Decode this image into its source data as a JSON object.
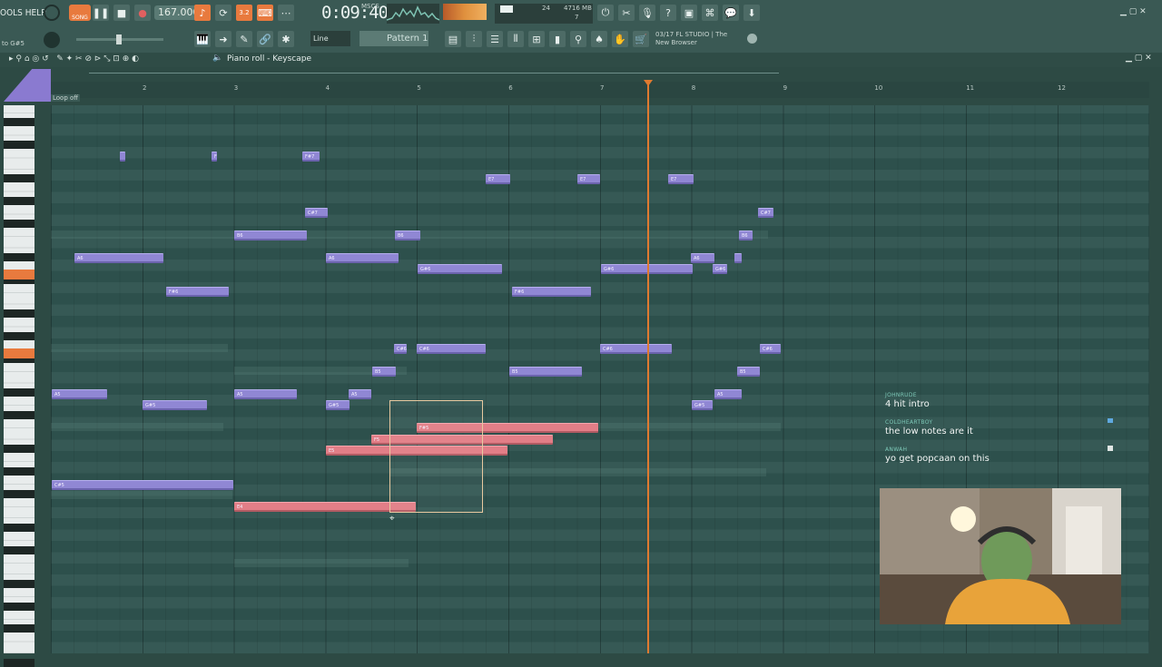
{
  "menu": {
    "tools_help": "OOLS HELP",
    "to_note": "to G#5",
    "song_label": "SONG"
  },
  "transport": {
    "tempo": "167.000",
    "time": "0:09:40",
    "time_sub": "MSCS",
    "pattern_sel": "3.2"
  },
  "resources": {
    "cpu": "24",
    "mem": "4716 MB",
    "polyphony": "7"
  },
  "toolbar2": {
    "tool_mode": "Line",
    "pattern": "Pattern 1"
  },
  "news": {
    "line1": "03/17  FL STUDIO | The",
    "line2": "New Browser"
  },
  "pianoroll": {
    "title": "Piano roll - Keyscape",
    "loop": "Loop off",
    "bars": [
      "2",
      "3",
      "4",
      "5",
      "6",
      "7",
      "8",
      "9",
      "10",
      "11",
      "12"
    ]
  },
  "notes": [
    {
      "label": "",
      "color": "purple"
    },
    {
      "label": "F",
      "color": "purple"
    },
    {
      "label": "F#7",
      "color": "purple"
    },
    {
      "label": "E7",
      "color": "purple"
    },
    {
      "label": "E7",
      "color": "purple"
    },
    {
      "label": "E7",
      "color": "purple"
    },
    {
      "label": "C#7",
      "color": "purple"
    },
    {
      "label": "C#7",
      "color": "purple"
    },
    {
      "label": "B6",
      "color": "purple"
    },
    {
      "label": "B6",
      "color": "purple"
    },
    {
      "label": "B6",
      "color": "purple"
    },
    {
      "label": "A6",
      "color": "purple"
    },
    {
      "label": "A6",
      "color": "purple"
    },
    {
      "label": "A6",
      "color": "purple"
    },
    {
      "label": "",
      "color": "purple"
    },
    {
      "label": "G#6",
      "color": "purple"
    },
    {
      "label": "G#6",
      "color": "purple"
    },
    {
      "label": "G#6",
      "color": "purple"
    },
    {
      "label": "F#6",
      "color": "purple"
    },
    {
      "label": "F#6",
      "color": "purple"
    },
    {
      "label": "C#6",
      "color": "purple"
    },
    {
      "label": "C#6",
      "color": "purple"
    },
    {
      "label": "C#6",
      "color": "purple"
    },
    {
      "label": "C#6",
      "color": "purple"
    },
    {
      "label": "B5",
      "color": "purple"
    },
    {
      "label": "B5",
      "color": "purple"
    },
    {
      "label": "B5",
      "color": "purple"
    },
    {
      "label": "A5",
      "color": "purple"
    },
    {
      "label": "A5",
      "color": "purple"
    },
    {
      "label": "A5",
      "color": "purple"
    },
    {
      "label": "A5",
      "color": "purple"
    },
    {
      "label": "G#5",
      "color": "purple"
    },
    {
      "label": "G#5",
      "color": "purple"
    },
    {
      "label": "G#5",
      "color": "purple"
    },
    {
      "label": "F#5",
      "color": "pink"
    },
    {
      "label": "F5",
      "color": "pink"
    },
    {
      "label": "E5",
      "color": "pink"
    },
    {
      "label": "C#5",
      "color": "purple"
    },
    {
      "label": "E4",
      "color": "pink"
    }
  ],
  "chat": [
    {
      "user": "JOHNRUDE",
      "msg": "4 hit intro"
    },
    {
      "user": "COLDHEARTBOY",
      "msg": "the low notes are it"
    },
    {
      "user": "ANWAH",
      "msg": "yo get popcaan on this"
    }
  ],
  "colors": {
    "accent": "#e87a3e",
    "note_purple": "#9087d4",
    "note_pink": "#e27e87",
    "playhead": "#e07a30"
  }
}
